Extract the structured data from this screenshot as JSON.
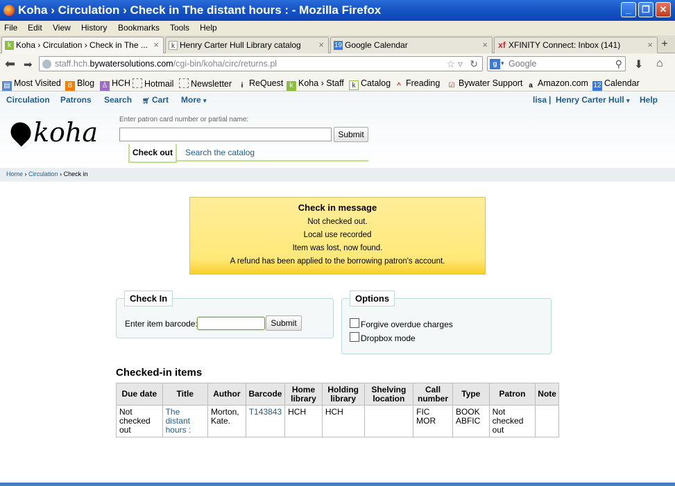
{
  "window": {
    "title": "Koha › Circulation › Check in The distant hours : - Mozilla Firefox"
  },
  "menu": [
    "File",
    "Edit",
    "View",
    "History",
    "Bookmarks",
    "Tools",
    "Help"
  ],
  "tabs": [
    {
      "label": "Koha › Circulation › Check in The ...",
      "active": true
    },
    {
      "label": "Henry Carter Hull Library catalog"
    },
    {
      "label": "Google Calendar"
    },
    {
      "label": "XFINITY Connect: Inbox (141)"
    }
  ],
  "tab_close": "×",
  "new_tab": "+",
  "nav": {
    "url_prefix": "staff.hch.",
    "url_host": "bywatersolutions.com",
    "url_path": "/cgi-bin/koha/circ/returns.pl",
    "search_placeholder": "Google"
  },
  "bookmarks": [
    "Most Visited",
    "Blog",
    "HCH",
    "Hotmail",
    "Newsletter",
    "ReQuest",
    "Koha › Staff",
    "Catalog",
    "Freading",
    "Bywater Support",
    "Amazon.com",
    "Calendar"
  ],
  "koha": {
    "topnav": {
      "circulation": "Circulation",
      "patrons": "Patrons",
      "search": "Search",
      "cart": "Cart",
      "more": "More",
      "user": "lisa",
      "library": "Henry Carter Hull",
      "help": "Help"
    },
    "logo": "koha",
    "patron_label": "Enter patron card number or partial name:",
    "submit": "Submit",
    "tab_checkout": "Check out",
    "tab_search": "Search the catalog",
    "breadcrumb": {
      "home": "Home",
      "circulation": "Circulation",
      "current": "Check in"
    },
    "message": {
      "title": "Check in message",
      "lines": [
        "Not checked out.",
        "Local use recorded",
        "Item was lost, now found.",
        "A refund has been applied to the borrowing patron's account."
      ]
    },
    "checkin": {
      "legend": "Check In",
      "label": "Enter item barcode:",
      "submit": "Submit"
    },
    "options": {
      "legend": "Options",
      "forgive": "Forgive overdue charges",
      "dropbox": "Dropbox mode"
    },
    "checked_in_title": "Checked-in items",
    "table": {
      "headers": [
        "Due date",
        "Title",
        "Author",
        "Barcode",
        "Home library",
        "Holding library",
        "Shelving location",
        "Call number",
        "Type",
        "Patron",
        "Note"
      ],
      "row": [
        "Not checked out",
        "The distant hours :",
        "Morton, Kate.",
        "T143843",
        "HCH",
        "HCH",
        "",
        "FIC MOR",
        "BOOK ABFIC",
        "Not checked out",
        ""
      ]
    }
  }
}
